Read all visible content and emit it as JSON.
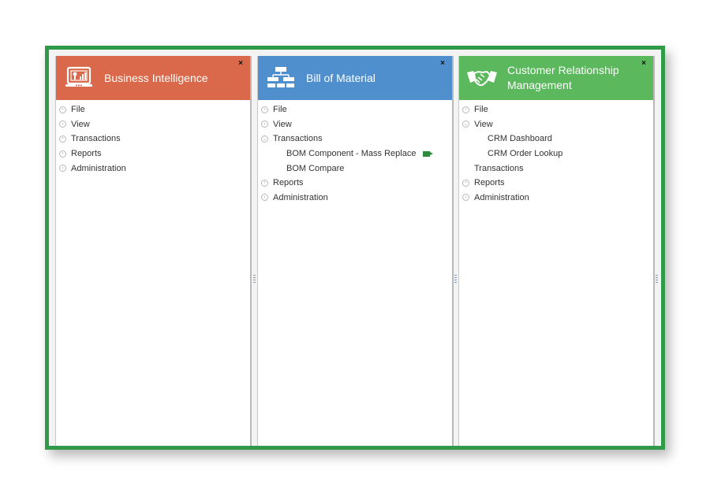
{
  "panels": [
    {
      "title": "Business Intelligence",
      "color": "#d9694a",
      "icon": "laptop-chart-icon",
      "close_label": "×",
      "menu": [
        {
          "label": "File",
          "arrow": "right"
        },
        {
          "label": "View",
          "arrow": "right"
        },
        {
          "label": "Transactions",
          "arrow": "right"
        },
        {
          "label": "Reports",
          "arrow": "right"
        },
        {
          "label": "Administration",
          "arrow": "right"
        }
      ]
    },
    {
      "title": "Bill of Material",
      "color": "#4f8fcd",
      "icon": "hierarchy-icon",
      "close_label": "×",
      "menu": [
        {
          "label": "File",
          "arrow": "right"
        },
        {
          "label": "View",
          "arrow": "right"
        },
        {
          "label": "Transactions",
          "arrow": "down"
        },
        {
          "label": "BOM Component - Mass Replace",
          "sub": true,
          "video": true
        },
        {
          "label": "BOM Compare",
          "sub": true
        },
        {
          "label": "Reports",
          "arrow": "right"
        },
        {
          "label": "Administration",
          "arrow": "right"
        }
      ]
    },
    {
      "title": "Customer Relationship Management",
      "color": "#5bb85d",
      "icon": "handshake-icon",
      "close_label": "×",
      "menu": [
        {
          "label": "File",
          "arrow": "right"
        },
        {
          "label": "View",
          "arrow": "down"
        },
        {
          "label": "CRM Dashboard",
          "sub": true
        },
        {
          "label": "CRM Order Lookup",
          "sub": true
        },
        {
          "label": "Transactions",
          "arrow": "none"
        },
        {
          "label": "Reports",
          "arrow": "right"
        },
        {
          "label": "Administration",
          "arrow": "right"
        }
      ]
    }
  ],
  "frame_color": "#2f9a47"
}
